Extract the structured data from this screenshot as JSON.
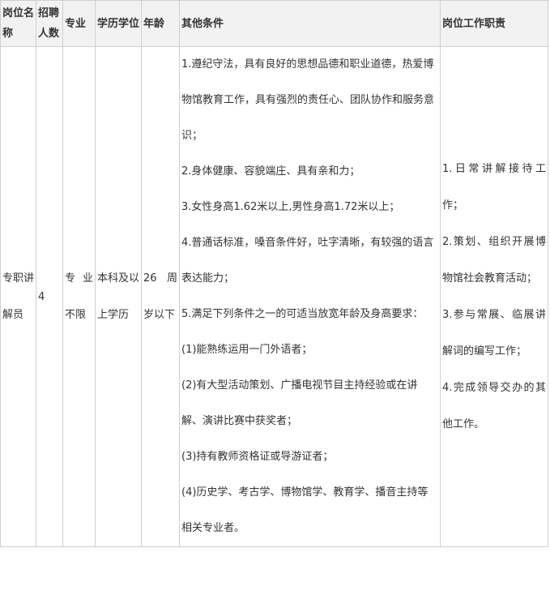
{
  "headers": {
    "name": "岗位名称",
    "count": "招聘人数",
    "major": "专业",
    "education": "学历学位",
    "age": "年龄",
    "conditions": "其他条件",
    "duties": "岗位工作职责"
  },
  "row": {
    "name": "专职讲解员",
    "count": "4",
    "major": "专业不限",
    "education": "本科及以上学历",
    "age": "26周岁以下",
    "conditions": [
      "1.遵纪守法，具有良好的思想品德和职业道德，热爱博物馆教育工作，具有强烈的责任心、团队协作和服务意识；",
      "2.身体健康、容貌端庄、具有亲和力；",
      "3.女性身高1.62米以上,男性身高1.72米以上；",
      "4.普通话标准，嗓音条件好，吐字清晰，有较强的语言表达能力；",
      "5.满足下列条件之一的可适当放宽年龄及身高要求：",
      "(1)能熟练运用一门外语者；",
      "(2)有大型活动策划、广播电视节目主持经验或在讲解、演讲比赛中获奖者；",
      "(3)持有教师资格证或导游证者；",
      "(4)历史学、考古学、博物馆学、教育学、播音主持等相关专业者。"
    ],
    "duties": [
      "1.日常讲解接待工作；",
      "2.策划、组织开展博物馆社会教育活动；",
      "3.参与常展、临展讲解词的编写工作；",
      "4.完成领导交办的其他工作。"
    ]
  }
}
